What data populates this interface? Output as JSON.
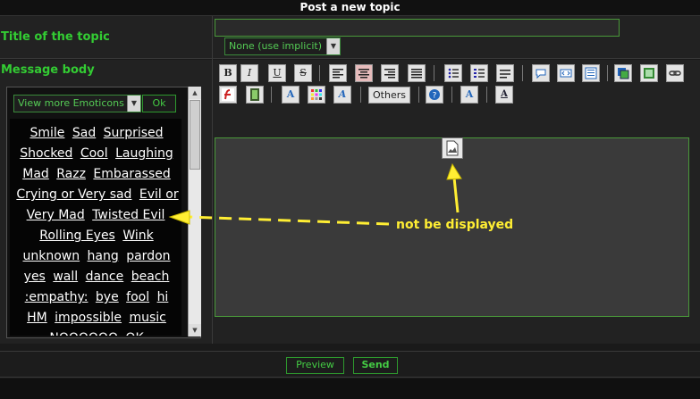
{
  "header": {
    "title": "Post a new topic"
  },
  "form": {
    "title_label": "Title of the topic",
    "message_label": "Message body",
    "topic_type_selected": "None (use implicit)"
  },
  "emoticons": {
    "select_label": "View more Emoticons",
    "ok_label": "Ok",
    "items": [
      "Smile",
      "Sad",
      "Surprised",
      "Shocked",
      "Cool",
      "Laughing",
      "Mad",
      "Razz",
      "Embarassed",
      "Crying or Very sad",
      "Evil or Very Mad",
      "Twisted Evil",
      "Rolling Eyes",
      "Wink",
      "unknown",
      "hang",
      "pardon",
      "yes",
      "wall",
      "dance",
      "beach",
      ":empathy:",
      "bye",
      "fool",
      "hi",
      "HM",
      "impossible",
      "music",
      "NOOOOOO",
      "OK"
    ]
  },
  "toolbar": {
    "others_label": "Others",
    "buttons": [
      "bold",
      "italic",
      "underline",
      "strikethrough",
      "align-left",
      "align-center",
      "align-right",
      "justify",
      "bullet-list",
      "numbered-list",
      "horizontal-rule",
      "quote",
      "code",
      "table",
      "link",
      "flash",
      "video",
      "font",
      "color",
      "font-face",
      "others",
      "help",
      "clear",
      "font-size"
    ]
  },
  "annotation": {
    "text": "not be displayed",
    "color": "#ffee33"
  },
  "actions": {
    "preview_label": "Preview",
    "send_label": "Send"
  },
  "colors": {
    "accent": "#33cc33",
    "background": "#1a1a1a",
    "annotation": "#ffee33"
  }
}
